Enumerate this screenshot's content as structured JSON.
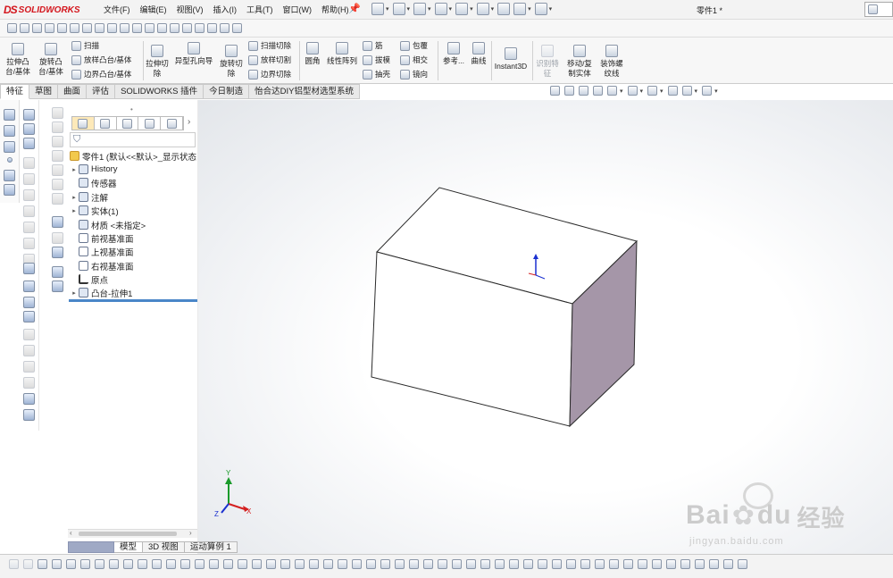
{
  "app": {
    "brand": "SOLIDWORKS",
    "brand_prefix": "DS",
    "document_title": "零件1 *"
  },
  "menu": [
    "文件(F)",
    "编辑(E)",
    "视图(V)",
    "插入(I)",
    "工具(T)",
    "窗口(W)",
    "帮助(H)"
  ],
  "ribbon": {
    "extrude_boss": "拉伸凸台/基体",
    "revolve_boss": "旋转凸台/基体",
    "sweep": "扫描",
    "loft_boss": "放样凸台/基体",
    "boundary_boss": "边界凸台/基体",
    "extrude_cut": "拉伸切除",
    "hole_wizard": "异型孔向导",
    "revolve_cut": "旋转切除",
    "swept_cut": "扫描切除",
    "lofted_cut": "放样切割",
    "boundary_cut": "边界切除",
    "fillet": "圆角",
    "linear_pattern": "线性阵列",
    "rib": "筋",
    "draft": "拔模",
    "shell": "抽壳",
    "wrap": "包覆",
    "intersect": "相交",
    "mirror": "镜向",
    "reference": "参考...",
    "curves": "曲线",
    "instant3d": "Instant3D",
    "recognize": "识别特征",
    "move_copy": "移动/复制实体",
    "cosmetic_thread": "装饰螺纹线"
  },
  "tabs": [
    "特征",
    "草图",
    "曲面",
    "评估",
    "SOLIDWORKS 插件",
    "今日制造",
    "怡合达DIY铝型材选型系统"
  ],
  "active_tab": "特征",
  "feature_tree": {
    "root": "零件1 (默认<<默认>_显示状态",
    "items": [
      "History",
      "传感器",
      "注解",
      "实体(1)",
      "材质 <未指定>",
      "前视基准面",
      "上视基准面",
      "右视基准面",
      "原点",
      "凸台-拉伸1"
    ]
  },
  "bottom_tabs": [
    "模型",
    "3D 视图",
    "运动算例 1"
  ],
  "active_bottom_tab": "模型",
  "triad": {
    "x": "X",
    "y": "Y",
    "z": "Z"
  },
  "watermark": {
    "brand": "Bai",
    "brand2": "du",
    "cn": "经验",
    "url": "jingyan.baidu.com"
  },
  "colors": {
    "accent": "#d4161d",
    "box_side": "#a596a8",
    "axis_x": "#d42020",
    "axis_y": "#1a9a2a",
    "axis_z": "#1a30d0"
  }
}
